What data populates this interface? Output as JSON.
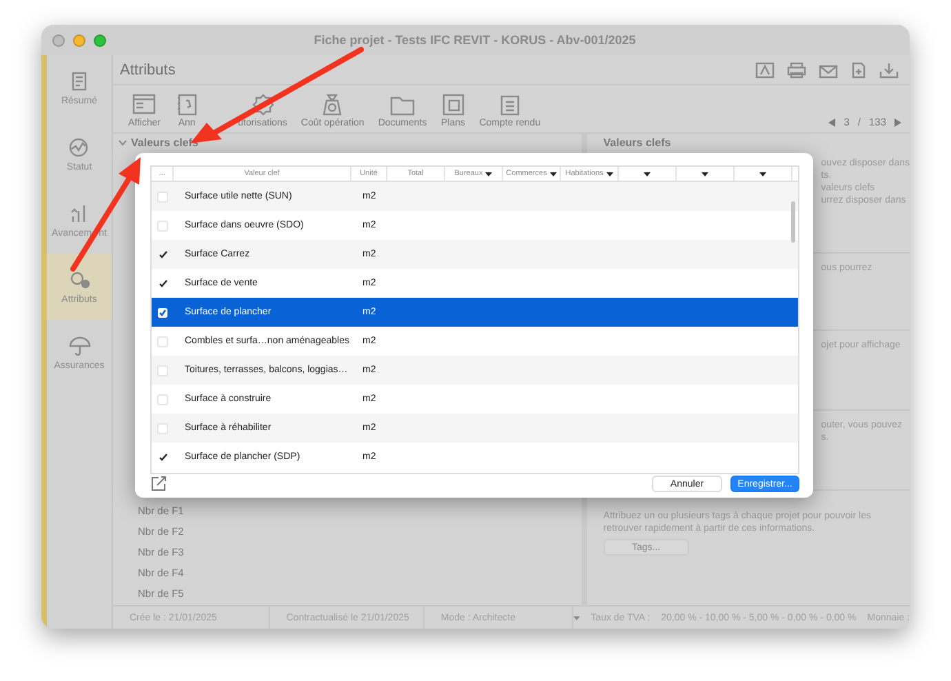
{
  "window": {
    "title": "Fiche projet - Tests IFC REVIT - KORUS - Abv-001/2025"
  },
  "sidebar": {
    "items": [
      {
        "label": "Résumé",
        "selected": false
      },
      {
        "label": "Statut",
        "selected": false
      },
      {
        "label": "Avancem",
        "label_after": "nt",
        "selected": false
      },
      {
        "label": "Attributs",
        "selected": true
      },
      {
        "label": "Assurances",
        "selected": false
      }
    ]
  },
  "header": {
    "title": "Attributs"
  },
  "toolbar": {
    "buttons": [
      {
        "label": "Afficher"
      },
      {
        "label": "Ann"
      },
      {
        "label": "utorisations"
      },
      {
        "label": "Coût opération"
      },
      {
        "label": "Documents"
      },
      {
        "label": "Plans"
      },
      {
        "label": "Compte rendu"
      }
    ]
  },
  "pager": {
    "page": "3",
    "separator": "/",
    "total": "133"
  },
  "section": {
    "title": "Valeurs clefs",
    "expanded": true,
    "rows": [
      "Nbr de F1",
      "Nbr de F2",
      "Nbr de F3",
      "Nbr de F4",
      "Nbr de F5"
    ]
  },
  "help_panel": {
    "title": "Valeurs clefs",
    "blocks": [
      [
        "ouvez disposer dans",
        "ts.",
        "valeurs clefs",
        "urrez disposer dans"
      ],
      [
        "ous pourrez"
      ],
      [
        "ojet pour affichage"
      ],
      [
        "outer, vous pouvez",
        "s."
      ]
    ],
    "tags_text": "Attribuez un ou plusieurs tags à chaque projet pour pouvoir les retrouver rapidement à partir de ces informations.",
    "tags_button": "Tags..."
  },
  "dialog": {
    "columns": [
      {
        "label": "...",
        "menu": false
      },
      {
        "label": "Valeur clef",
        "menu": false
      },
      {
        "label": "Unité",
        "menu": false
      },
      {
        "label": "Total",
        "menu": false
      },
      {
        "label": "Bureaux",
        "menu": true
      },
      {
        "label": "Commerces",
        "menu": true
      },
      {
        "label": "Habitations",
        "menu": true
      },
      {
        "menu": true
      },
      {
        "menu": true
      },
      {
        "menu": true
      }
    ],
    "rows": [
      {
        "label": "Surface utile nette (SUN)",
        "unit": "m2",
        "checked": false,
        "selected": false
      },
      {
        "label": "Surface dans oeuvre (SDO)",
        "unit": "m2",
        "checked": false,
        "selected": false
      },
      {
        "label": "Surface Carrez",
        "unit": "m2",
        "checked": true,
        "selected": false
      },
      {
        "label": "Surface de vente",
        "unit": "m2",
        "checked": true,
        "selected": false
      },
      {
        "label": "Surface de plancher",
        "unit": "m2",
        "checked": true,
        "selected": true
      },
      {
        "label": "Combles et surfa…non aménageables",
        "unit": "m2",
        "checked": false,
        "selected": false
      },
      {
        "label": "Toitures, terrasses, balcons, loggias…",
        "unit": "m2",
        "checked": false,
        "selected": false
      },
      {
        "label": "Surface à construire",
        "unit": "m2",
        "checked": false,
        "selected": false
      },
      {
        "label": "Surface à réhabiliter",
        "unit": "m2",
        "checked": false,
        "selected": false
      },
      {
        "label": "Surface de plancher (SDP)",
        "unit": "m2",
        "checked": true,
        "selected": false
      }
    ],
    "buttons": [
      {
        "label": "Annuler",
        "kind": "cancel"
      },
      {
        "label": "Enregistrer...",
        "kind": "primary"
      }
    ]
  },
  "status_bar": {
    "items": [
      "Crée le : 21/01/2025",
      "Contractualisé le 21/01/2025",
      "Mode : Architecte"
    ],
    "vat_label": "Taux de TVA :",
    "vat_rates": "20,00 % - 10,00 % - 5,00 % - 0,00 % - 0,00 %",
    "currency_label": "Monnaie :"
  }
}
